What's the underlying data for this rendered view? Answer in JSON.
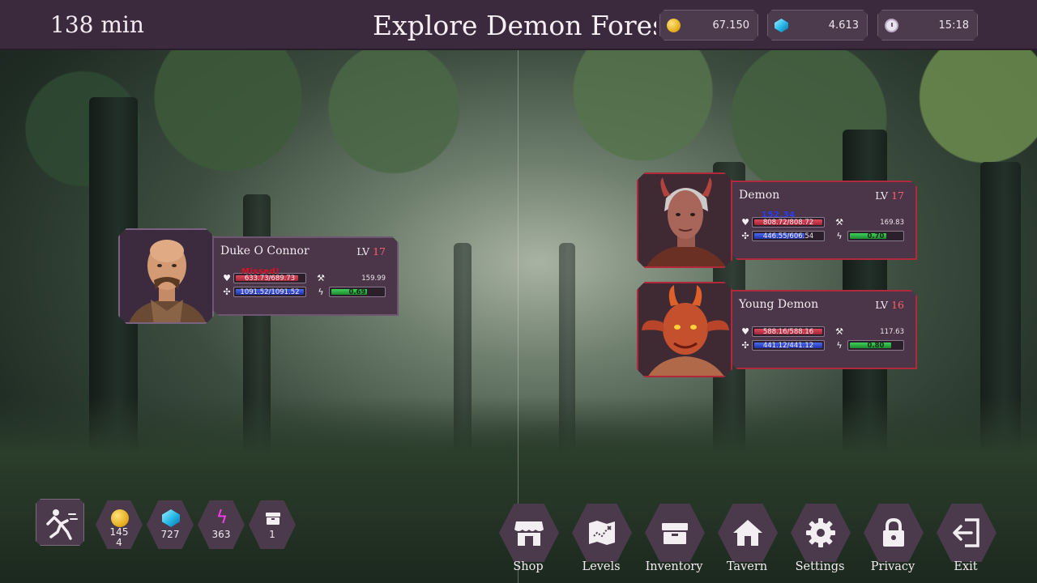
{
  "header": {
    "timer": "138 min",
    "title": "Explore Demon Forest",
    "resources": [
      {
        "name": "coins",
        "icon": "coin-icon",
        "value": "67.150"
      },
      {
        "name": "gems",
        "icon": "gem-icon",
        "value": "4.613"
      },
      {
        "name": "time",
        "icon": "clock-icon",
        "value": "15:18"
      }
    ]
  },
  "player": {
    "name": "Duke O Connor",
    "lv_label": "LV",
    "lv": "17",
    "hp": "633.73/689.73",
    "hp_ratio": 0.919,
    "mp": "1091.52/1091.52",
    "mp_ratio": 1.0,
    "attack": "159.99",
    "speed": "0.69",
    "speed_ratio": 0.69,
    "float_text": "Missed!",
    "float_color": "#e01020"
  },
  "enemies": [
    {
      "name": "Demon",
      "lv_label": "LV",
      "lv": "17",
      "hp": "808.72/808.72",
      "hp_ratio": 1.0,
      "mp": "446.55/606.54",
      "mp_ratio": 0.736,
      "attack": "169.83",
      "speed": "0.70",
      "speed_ratio": 0.7,
      "float_text": "152.34",
      "float_color": "#2a3cff"
    },
    {
      "name": "Young Demon",
      "lv_label": "LV",
      "lv": "16",
      "hp": "588.16/588.16",
      "hp_ratio": 1.0,
      "mp": "441.12/441.12",
      "mp_ratio": 1.0,
      "attack": "117.63",
      "speed": "0.80",
      "speed_ratio": 0.8
    }
  ],
  "inventory_counts": {
    "coins": "145\n4",
    "gems": "727",
    "energy": "363",
    "chests": "1"
  },
  "nav": [
    {
      "label": "Shop",
      "icon": "shop-icon"
    },
    {
      "label": "Levels",
      "icon": "map-icon"
    },
    {
      "label": "Inventory",
      "icon": "chest-icon"
    },
    {
      "label": "Tavern",
      "icon": "house-icon"
    },
    {
      "label": "Settings",
      "icon": "gear-icon"
    },
    {
      "label": "Privacy",
      "icon": "lock-icon"
    },
    {
      "label": "Exit",
      "icon": "exit-icon"
    }
  ],
  "colors": {
    "panel": "#4a3549",
    "enemy_border": "#b02a3c",
    "level_number": "#ff5e6a",
    "hp_bar": "#c0344a",
    "mp_bar": "#3348d0",
    "speed_bar": "#2fb046"
  }
}
